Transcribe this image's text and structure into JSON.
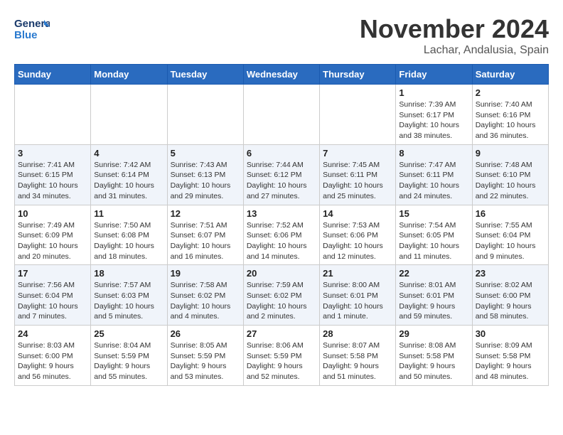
{
  "logo": {
    "line1": "General",
    "line2": "Blue"
  },
  "header": {
    "month": "November 2024",
    "location": "Lachar, Andalusia, Spain"
  },
  "weekdays": [
    "Sunday",
    "Monday",
    "Tuesday",
    "Wednesday",
    "Thursday",
    "Friday",
    "Saturday"
  ],
  "weeks": [
    [
      {
        "day": "",
        "info": ""
      },
      {
        "day": "",
        "info": ""
      },
      {
        "day": "",
        "info": ""
      },
      {
        "day": "",
        "info": ""
      },
      {
        "day": "",
        "info": ""
      },
      {
        "day": "1",
        "info": "Sunrise: 7:39 AM\nSunset: 6:17 PM\nDaylight: 10 hours\nand 38 minutes."
      },
      {
        "day": "2",
        "info": "Sunrise: 7:40 AM\nSunset: 6:16 PM\nDaylight: 10 hours\nand 36 minutes."
      }
    ],
    [
      {
        "day": "3",
        "info": "Sunrise: 7:41 AM\nSunset: 6:15 PM\nDaylight: 10 hours\nand 34 minutes."
      },
      {
        "day": "4",
        "info": "Sunrise: 7:42 AM\nSunset: 6:14 PM\nDaylight: 10 hours\nand 31 minutes."
      },
      {
        "day": "5",
        "info": "Sunrise: 7:43 AM\nSunset: 6:13 PM\nDaylight: 10 hours\nand 29 minutes."
      },
      {
        "day": "6",
        "info": "Sunrise: 7:44 AM\nSunset: 6:12 PM\nDaylight: 10 hours\nand 27 minutes."
      },
      {
        "day": "7",
        "info": "Sunrise: 7:45 AM\nSunset: 6:11 PM\nDaylight: 10 hours\nand 25 minutes."
      },
      {
        "day": "8",
        "info": "Sunrise: 7:47 AM\nSunset: 6:11 PM\nDaylight: 10 hours\nand 24 minutes."
      },
      {
        "day": "9",
        "info": "Sunrise: 7:48 AM\nSunset: 6:10 PM\nDaylight: 10 hours\nand 22 minutes."
      }
    ],
    [
      {
        "day": "10",
        "info": "Sunrise: 7:49 AM\nSunset: 6:09 PM\nDaylight: 10 hours\nand 20 minutes."
      },
      {
        "day": "11",
        "info": "Sunrise: 7:50 AM\nSunset: 6:08 PM\nDaylight: 10 hours\nand 18 minutes."
      },
      {
        "day": "12",
        "info": "Sunrise: 7:51 AM\nSunset: 6:07 PM\nDaylight: 10 hours\nand 16 minutes."
      },
      {
        "day": "13",
        "info": "Sunrise: 7:52 AM\nSunset: 6:06 PM\nDaylight: 10 hours\nand 14 minutes."
      },
      {
        "day": "14",
        "info": "Sunrise: 7:53 AM\nSunset: 6:06 PM\nDaylight: 10 hours\nand 12 minutes."
      },
      {
        "day": "15",
        "info": "Sunrise: 7:54 AM\nSunset: 6:05 PM\nDaylight: 10 hours\nand 11 minutes."
      },
      {
        "day": "16",
        "info": "Sunrise: 7:55 AM\nSunset: 6:04 PM\nDaylight: 10 hours\nand 9 minutes."
      }
    ],
    [
      {
        "day": "17",
        "info": "Sunrise: 7:56 AM\nSunset: 6:04 PM\nDaylight: 10 hours\nand 7 minutes."
      },
      {
        "day": "18",
        "info": "Sunrise: 7:57 AM\nSunset: 6:03 PM\nDaylight: 10 hours\nand 5 minutes."
      },
      {
        "day": "19",
        "info": "Sunrise: 7:58 AM\nSunset: 6:02 PM\nDaylight: 10 hours\nand 4 minutes."
      },
      {
        "day": "20",
        "info": "Sunrise: 7:59 AM\nSunset: 6:02 PM\nDaylight: 10 hours\nand 2 minutes."
      },
      {
        "day": "21",
        "info": "Sunrise: 8:00 AM\nSunset: 6:01 PM\nDaylight: 10 hours\nand 1 minute."
      },
      {
        "day": "22",
        "info": "Sunrise: 8:01 AM\nSunset: 6:01 PM\nDaylight: 9 hours\nand 59 minutes."
      },
      {
        "day": "23",
        "info": "Sunrise: 8:02 AM\nSunset: 6:00 PM\nDaylight: 9 hours\nand 58 minutes."
      }
    ],
    [
      {
        "day": "24",
        "info": "Sunrise: 8:03 AM\nSunset: 6:00 PM\nDaylight: 9 hours\nand 56 minutes."
      },
      {
        "day": "25",
        "info": "Sunrise: 8:04 AM\nSunset: 5:59 PM\nDaylight: 9 hours\nand 55 minutes."
      },
      {
        "day": "26",
        "info": "Sunrise: 8:05 AM\nSunset: 5:59 PM\nDaylight: 9 hours\nand 53 minutes."
      },
      {
        "day": "27",
        "info": "Sunrise: 8:06 AM\nSunset: 5:59 PM\nDaylight: 9 hours\nand 52 minutes."
      },
      {
        "day": "28",
        "info": "Sunrise: 8:07 AM\nSunset: 5:58 PM\nDaylight: 9 hours\nand 51 minutes."
      },
      {
        "day": "29",
        "info": "Sunrise: 8:08 AM\nSunset: 5:58 PM\nDaylight: 9 hours\nand 50 minutes."
      },
      {
        "day": "30",
        "info": "Sunrise: 8:09 AM\nSunset: 5:58 PM\nDaylight: 9 hours\nand 48 minutes."
      }
    ]
  ]
}
